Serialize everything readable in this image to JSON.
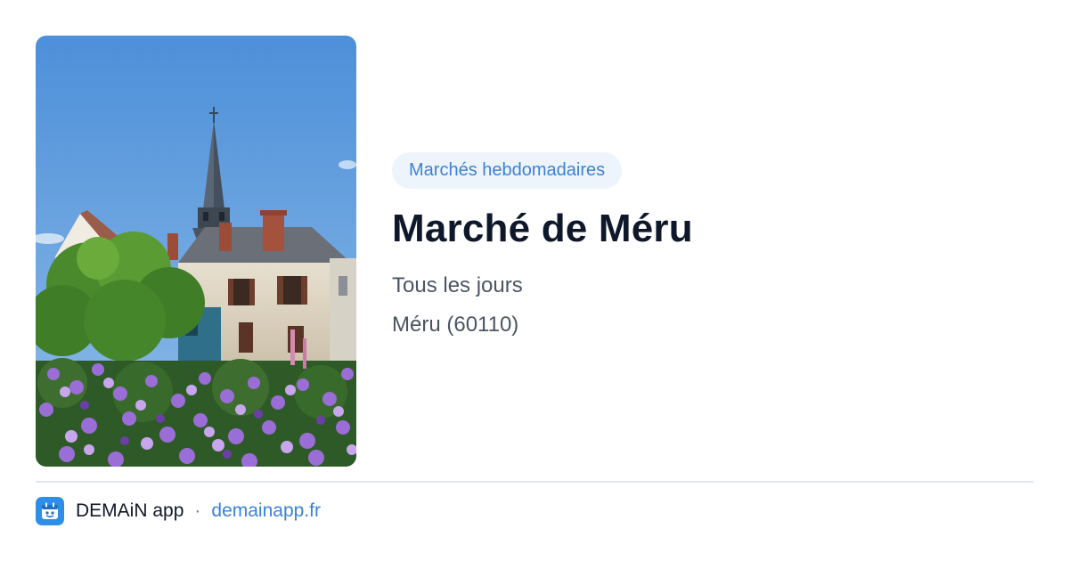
{
  "photo": {
    "subject": "church-spire-and-flowers-photo"
  },
  "market": {
    "category": "Marchés hebdomadaires",
    "name": "Marché de Méru",
    "schedule": "Tous les jours",
    "location": "Méru (60110)"
  },
  "footer": {
    "app_name": "DEMAiN app",
    "separator": "·",
    "link": "demainapp.fr",
    "logo_icon": "demain-app-logo-icon"
  },
  "colors": {
    "accent": "#3b82d6",
    "badge_bg": "#eef4fc",
    "title": "#0f172a",
    "muted_text": "#4b5563",
    "divider": "#dde6ee",
    "logo_bg": "#2f8fe6"
  }
}
